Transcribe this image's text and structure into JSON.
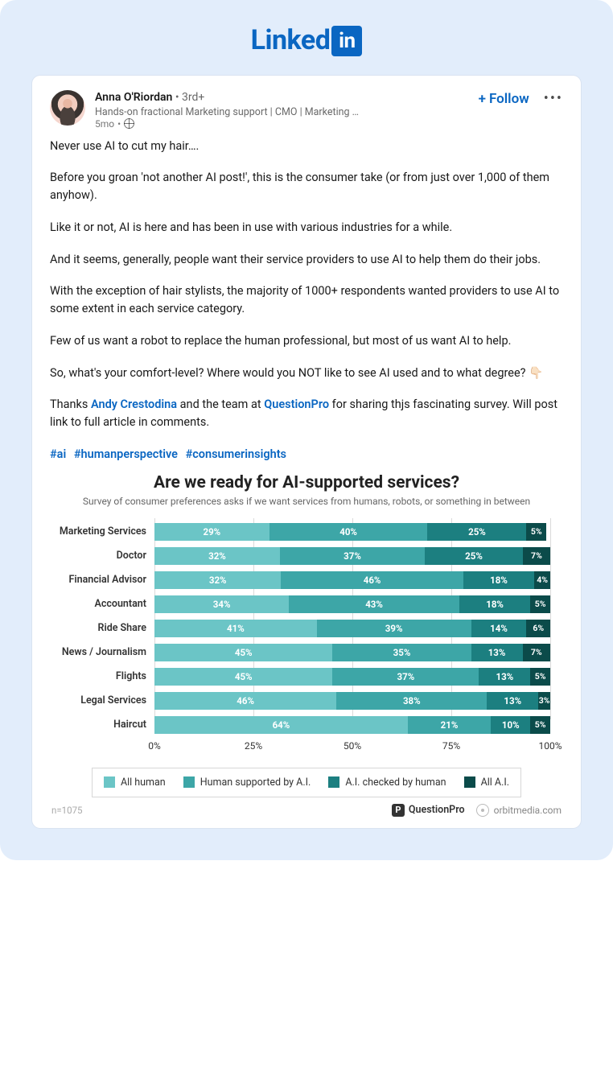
{
  "brand": {
    "name": "Linked",
    "badge": "in"
  },
  "post": {
    "author": {
      "name": "Anna O'Riordan",
      "degree": "3rd+",
      "headline": "Hands-on fractional Marketing support | CMO | Marketing …",
      "time": "5mo",
      "visibility": "public"
    },
    "actions": {
      "follow": "Follow"
    },
    "body": {
      "p1": "Never use AI to cut my hair….",
      "p2": "Before you groan 'not another AI post!', this is the consumer take (or from just over 1,000 of them anyhow).",
      "p3": "Like it or not, AI is here and has been in use with various industries for a while.",
      "p4": "And it seems, generally, people want their service providers to use AI to help them do their jobs.",
      "p5": "With the exception of hair stylists, the majority of 1000+ respondents wanted providers to use AI to some extent in each service category.",
      "p6": "Few of us want a robot to replace the human professional, but most of us want AI to help.",
      "p7": "So, what's your comfort-level? Where would you NOT like to see AI used and to what degree? 👇🏻",
      "thanks_pre": "Thanks ",
      "mention1": "Andy Crestodina",
      "thanks_mid": " and the team at ",
      "mention2": "QuestionPro",
      "thanks_end": " for sharing thjs fascinating survey. Will post link to full article in comments."
    },
    "hashtags": [
      "#ai",
      "#humanperspective",
      "#consumerinsights"
    ]
  },
  "chart_data": {
    "type": "bar",
    "title": "Are we ready for AI-supported services?",
    "subtitle": "Survey of consumer preferences asks if we want services from humans, robots, or something in between",
    "xlabel": "",
    "ylabel": "",
    "xlim": [
      0,
      100
    ],
    "ticks": [
      0,
      25,
      50,
      75,
      100
    ],
    "n_label": "n=1075",
    "categories": [
      "Marketing Services",
      "Doctor",
      "Financial Advisor",
      "Accountant",
      "Ride Share",
      "News / Journalism",
      "Flights",
      "Legal Services",
      "Haircut"
    ],
    "series": [
      {
        "name": "All human",
        "color": "#6bc5c6",
        "values": [
          29,
          32,
          32,
          34,
          41,
          45,
          45,
          46,
          64
        ]
      },
      {
        "name": "Human supported by A.I.",
        "color": "#3da6a7",
        "values": [
          40,
          37,
          46,
          43,
          39,
          35,
          37,
          38,
          21
        ]
      },
      {
        "name": "A.I. checked by human",
        "color": "#1c7f80",
        "values": [
          25,
          25,
          18,
          18,
          14,
          13,
          13,
          13,
          10
        ]
      },
      {
        "name": "All A.I.",
        "color": "#0b4b4a",
        "values": [
          5,
          7,
          4,
          5,
          6,
          7,
          5,
          3,
          5
        ]
      }
    ],
    "attribution": {
      "source1": "QuestionPro",
      "source2": "orbitmedia.com"
    }
  }
}
